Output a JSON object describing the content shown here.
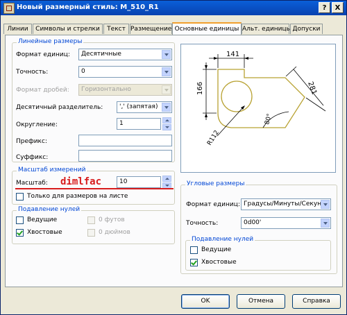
{
  "window": {
    "title": "Новый размерный стиль: M_510_R1",
    "help_button": "?",
    "close_button": "X"
  },
  "tabs": [
    {
      "label": "Линии"
    },
    {
      "label": "Символы и стрелки"
    },
    {
      "label": "Текст"
    },
    {
      "label": "Размещение"
    },
    {
      "label": "Основные единицы"
    },
    {
      "label": "Альт. единицы"
    },
    {
      "label": "Допуски"
    }
  ],
  "active_tab": "Основные единицы",
  "linear": {
    "title": "Линейные размеры",
    "unit_format_label": "Формат единиц:",
    "unit_format_value": "Десятичные",
    "precision_label": "Точность:",
    "precision_value": "0",
    "fraction_label": "Формат дробей:",
    "fraction_value": "Горизонтально",
    "decimal_sep_label": "Десятичный разделитель:",
    "decimal_sep_value": "',' (запятая)",
    "round_label": "Округление:",
    "round_value": "1",
    "prefix_label": "Префикс:",
    "prefix_value": "",
    "suffix_label": "Суффикс:",
    "suffix_value": ""
  },
  "scale": {
    "title": "Масштаб измерений",
    "scale_label": "Масштаб:",
    "scale_value": "10",
    "layout_only_label": "Только для размеров на листе",
    "layout_only_checked": false
  },
  "annotation": {
    "text": "dimlfac",
    "color": "#d81c1c"
  },
  "zero_linear": {
    "title": "Подавление нулей",
    "leading_label": "Ведущие",
    "leading_checked": false,
    "trailing_label": "Хвостовые",
    "trailing_checked": true,
    "feet_label": "0 футов",
    "inches_label": "0 дюймов"
  },
  "preview": {
    "dim_top": "141",
    "dim_left": "166",
    "dim_diag": "281",
    "dim_angle": "80°",
    "dim_radius": "R112"
  },
  "angular": {
    "title": "Угловые размеры",
    "unit_format_label": "Формат единиц:",
    "unit_format_value": "Градусы/Минуты/Секун,",
    "precision_label": "Точность:",
    "precision_value": "0d00'"
  },
  "zero_angular": {
    "title": "Подавление нулей",
    "leading_label": "Ведущие",
    "leading_checked": false,
    "trailing_label": "Хвостовые",
    "trailing_checked": true
  },
  "buttons": {
    "ok": "OK",
    "cancel": "Отмена",
    "help": "Справка"
  },
  "colors": {
    "accent": "#0046d5",
    "title_bar": "#0a5fd8",
    "preview_shape": "#b8a232",
    "preview_dim": "#000000"
  }
}
